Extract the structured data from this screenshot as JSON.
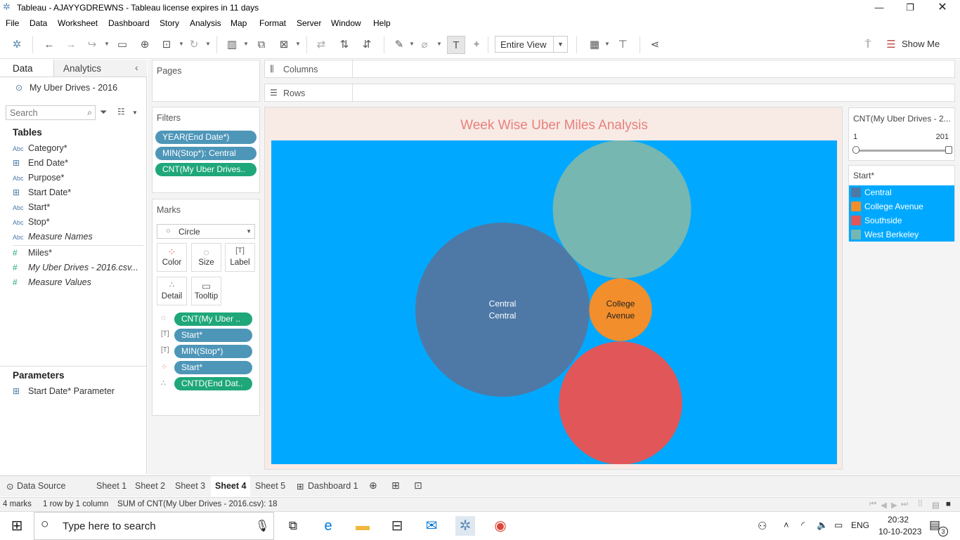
{
  "window": {
    "title": "Tableau - AJAYYGDREWNS - Tableau license expires in 11 days"
  },
  "menu": [
    "File",
    "Data",
    "Worksheet",
    "Dashboard",
    "Story",
    "Analysis",
    "Map",
    "Format",
    "Server",
    "Window",
    "Help"
  ],
  "toolbar": {
    "fit_value": "Entire View",
    "show_me_label": "Show Me"
  },
  "left_pane": {
    "tab_data": "Data",
    "tab_analytics": "Analytics",
    "datasource": "My Uber Drives - 2016",
    "search_placeholder": "Search",
    "tables_header": "Tables",
    "fields": [
      {
        "type": "Abc",
        "name": "Category*",
        "italic": false
      },
      {
        "type": "date",
        "name": "End Date*",
        "italic": false
      },
      {
        "type": "Abc",
        "name": "Purpose*",
        "italic": false
      },
      {
        "type": "date",
        "name": "Start Date*",
        "italic": false
      },
      {
        "type": "Abc",
        "name": "Start*",
        "italic": false
      },
      {
        "type": "Abc",
        "name": "Stop*",
        "italic": false
      },
      {
        "type": "Abc",
        "name": "Measure Names",
        "italic": true
      },
      {
        "type": "#",
        "name": "Miles*",
        "italic": false
      },
      {
        "type": "#",
        "name": "My Uber Drives - 2016.csv...",
        "italic": true
      },
      {
        "type": "#",
        "name": "Measure Values",
        "italic": true
      }
    ],
    "parameters_header": "Parameters",
    "parameters": [
      "Start Date* Parameter"
    ]
  },
  "pages_label": "Pages",
  "filters": {
    "label": "Filters",
    "pills": [
      {
        "text": "YEAR(End Date*)",
        "color": "blue"
      },
      {
        "text": "MIN(Stop*): Central",
        "color": "blue"
      },
      {
        "text": "CNT(My Uber Drives..",
        "color": "green"
      }
    ]
  },
  "marks": {
    "label": "Marks",
    "mark_type": "Circle",
    "buttons": [
      "Color",
      "Size",
      "Label",
      "Detail",
      "Tooltip"
    ],
    "pills": [
      {
        "icon": "size",
        "text": "CNT(My Uber ..",
        "color": "green"
      },
      {
        "icon": "label",
        "text": "Start*",
        "color": "blue"
      },
      {
        "icon": "label",
        "text": "MIN(Stop*)",
        "color": "blue"
      },
      {
        "icon": "color",
        "text": "Start*",
        "color": "blue"
      },
      {
        "icon": "detail",
        "text": "CNTD(End Dat..",
        "color": "green"
      }
    ]
  },
  "columns_label": "Columns",
  "rows_label": "Rows",
  "view": {
    "title": "Week Wise Uber Miles Analysis"
  },
  "chart_data": {
    "type": "packed bubble",
    "title": "Week Wise Uber Miles Analysis",
    "size_measure": "CNT(My Uber Drives - 2016.csv)",
    "color_dimension": "Start*",
    "bubbles": [
      {
        "category": "Central",
        "label": "Central\nCentral",
        "color": "#4e79a7",
        "relative_size": 1.0
      },
      {
        "category": "West Berkeley",
        "label": "",
        "color": "#76b7b2",
        "relative_size": 0.63
      },
      {
        "category": "Southside",
        "label": "",
        "color": "#e15759",
        "relative_size": 0.5
      },
      {
        "category": "College Avenue",
        "label": "College\nAvenue",
        "color": "#f28e2b",
        "relative_size": 0.13
      }
    ]
  },
  "slider_legend": {
    "title": "CNT(My Uber Drives - 2...",
    "min": "1",
    "max": "201"
  },
  "color_legend": {
    "title": "Start*",
    "items": [
      {
        "label": "Central",
        "color": "#4e79a7"
      },
      {
        "label": "College Avenue",
        "color": "#f28e2b"
      },
      {
        "label": "Southside",
        "color": "#e15759"
      },
      {
        "label": "West Berkeley",
        "color": "#76b7b2"
      }
    ]
  },
  "sheet_tabs": [
    "Data Source",
    "Sheet 1",
    "Sheet 2",
    "Sheet 3",
    "Sheet 4",
    "Sheet 5",
    "Dashboard 1"
  ],
  "active_sheet": "Sheet 4",
  "status": {
    "marks": "4 marks",
    "rows_cols": "1 row by 1 column",
    "sum": "SUM of CNT(My Uber Drives - 2016.csv): 18"
  },
  "taskbar": {
    "search_placeholder": "Type here to search",
    "lang": "ENG",
    "time": "20:32",
    "date": "10-10-2023",
    "notifications": "3"
  }
}
